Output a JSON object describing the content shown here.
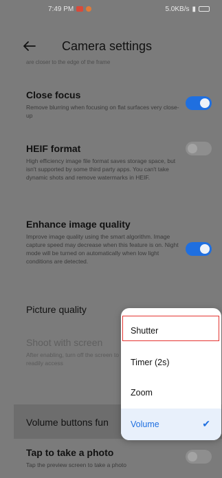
{
  "status_bar": {
    "time": "7:49 PM",
    "right": "5.0KB/s"
  },
  "header": {
    "title": "Camera settings"
  },
  "clipped_text": "are closer to the edge of the frame",
  "settings": {
    "close_focus": {
      "title": "Close focus",
      "desc": "Remove blurring when focusing on flat surfaces very close-up",
      "enabled": true
    },
    "heif": {
      "title": "HEIF format",
      "desc": "High efficiency image file format saves storage space, but isn't supported by some third party apps. You can't take dynamic shots and remove watermarks in HEIF.",
      "enabled": false
    },
    "enhance": {
      "title": "Enhance image quality",
      "desc": "Improve image quality using the smart algorithm. Image capture speed may decrease when this feature is on. Night mode will be turned on automatically when low light conditions are detected.",
      "enabled": true
    },
    "picture_quality": {
      "title": "Picture quality"
    },
    "shoot_with_screen": {
      "title": "Shoot with screen",
      "desc": "After enabling, turn off the screen to readily access"
    },
    "volume_buttons": {
      "title": "Volume buttons fun"
    },
    "tap_photo": {
      "title": "Tap to take a photo",
      "desc": "Tap the preview screen to take a photo",
      "enabled": false
    }
  },
  "popup": {
    "items": [
      {
        "label": "Shutter",
        "selected": false
      },
      {
        "label": "Timer (2s)",
        "selected": false
      },
      {
        "label": "Zoom",
        "selected": false
      },
      {
        "label": "Volume",
        "selected": true
      }
    ],
    "check_icon": "check-icon"
  },
  "colors": {
    "accent": "#1f6fe0",
    "focus_outline": "#e4332f",
    "dim_background": "#7b7b7b"
  }
}
